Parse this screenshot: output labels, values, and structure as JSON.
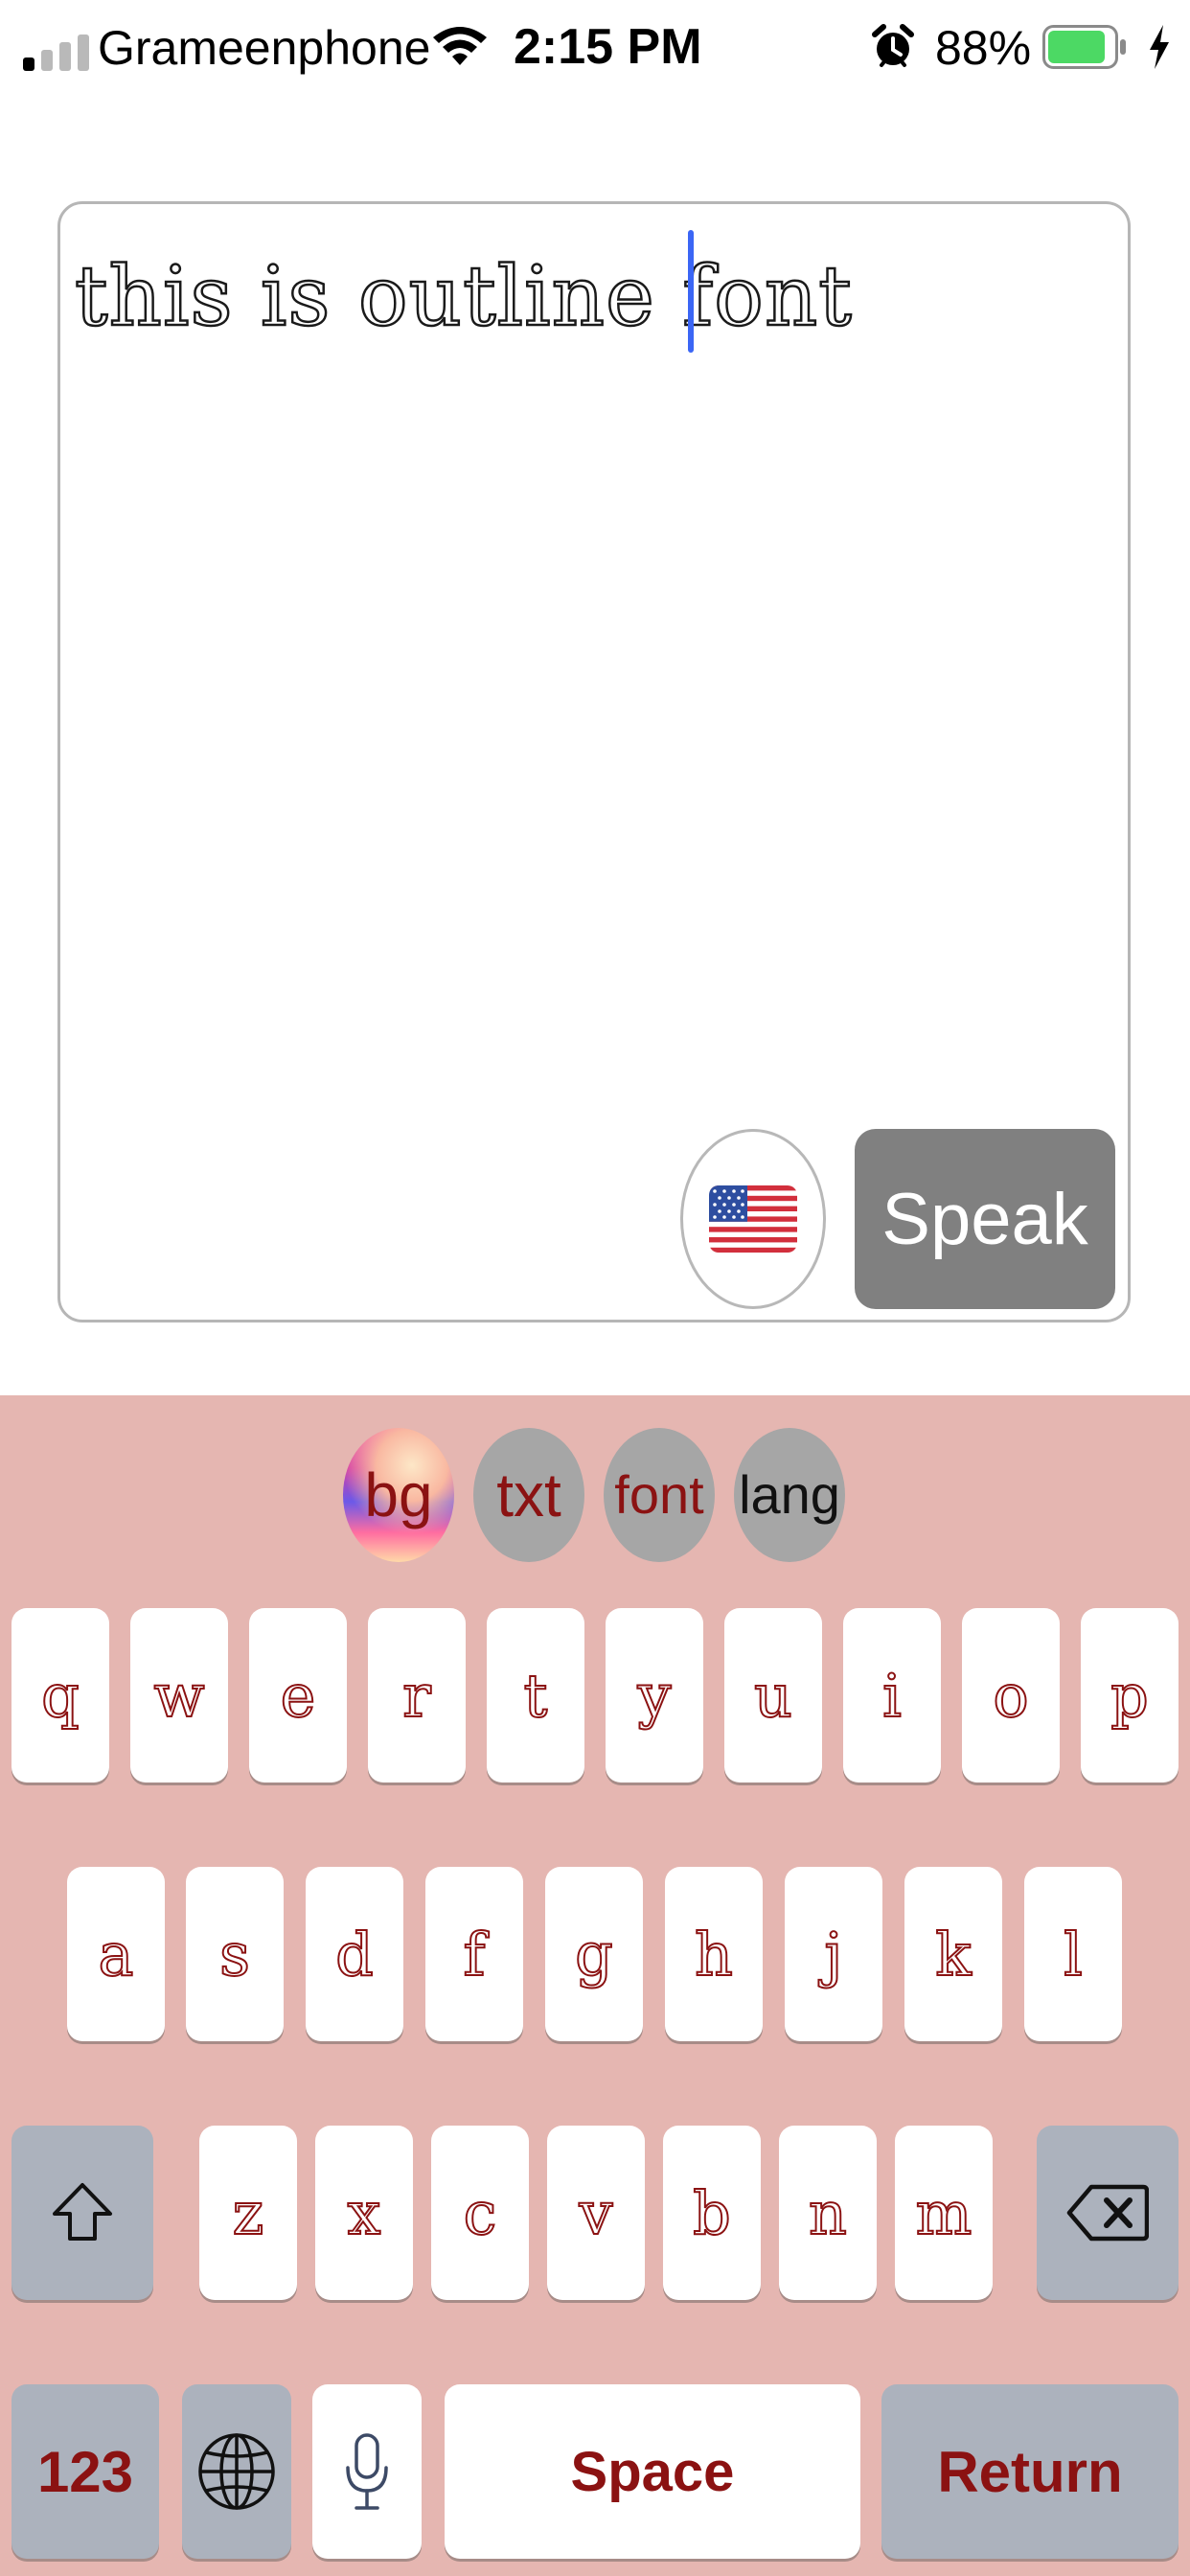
{
  "status_bar": {
    "carrier": "Grameenphone",
    "time": "2:15 PM",
    "battery_percent": "88%",
    "battery_level": 0.88
  },
  "editor": {
    "text": "this is outline font",
    "flag_icon": "us-flag-icon",
    "speak_label": "Speak"
  },
  "toolbar": {
    "chips": [
      {
        "label": "bg"
      },
      {
        "label": "txt"
      },
      {
        "label": "font"
      },
      {
        "label": "lang"
      }
    ]
  },
  "keyboard": {
    "row1": [
      "q",
      "w",
      "e",
      "r",
      "t",
      "y",
      "u",
      "i",
      "o",
      "p"
    ],
    "row2": [
      "a",
      "s",
      "d",
      "f",
      "g",
      "h",
      "j",
      "k",
      "l"
    ],
    "row3": [
      "z",
      "x",
      "c",
      "v",
      "b",
      "n",
      "m"
    ],
    "numbers_label": "123",
    "space_label": "Space",
    "return_label": "Return"
  },
  "colors": {
    "keyboard_bg": "#e5b6b1",
    "key_text": "#8b1212",
    "caret": "#3b66f5",
    "speak_bg": "#808080",
    "battery_green": "#4cd964"
  }
}
